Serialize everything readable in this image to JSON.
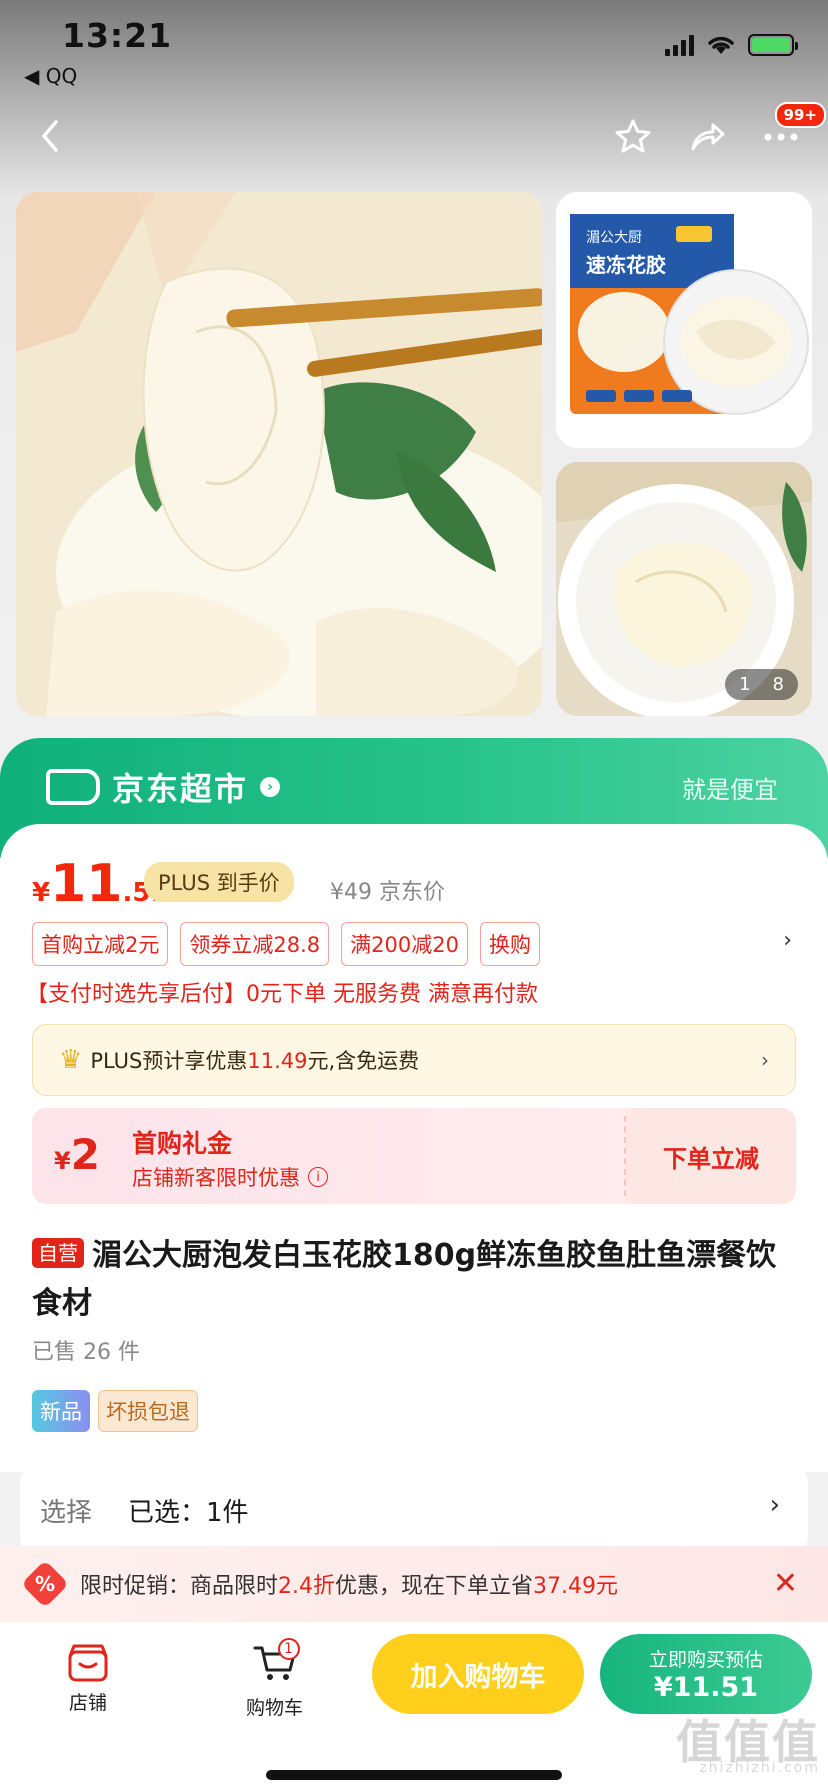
{
  "status_bar": {
    "time": "13:21",
    "back_app": "◀ QQ"
  },
  "nav": {
    "badge": "99+"
  },
  "gallery": {
    "counter_current": "1",
    "counter_total": "8"
  },
  "market": {
    "name": "京东超市",
    "slogan": "就是便宜"
  },
  "price": {
    "symbol": "¥",
    "integer": "11",
    "decimal": ".51",
    "plus_tag": "PLUS 到手价",
    "reference": "¥49 京东价"
  },
  "coupons": [
    "首购立减2元",
    "领券立减28.8",
    "满200减20",
    "换购"
  ],
  "pay_later": "【支付时选先享后付】0元下单 无服务费 满意再付款",
  "plus_bar": {
    "prefix": "PLUS预计享优惠",
    "amount": "11.49",
    "suffix": "元,含免运费"
  },
  "gift": {
    "symbol": "¥",
    "amount": "2",
    "title": "首购礼金",
    "subtitle": "店铺新客限时优惠",
    "info_icon": "i",
    "action": "下单立减"
  },
  "product": {
    "self_tag": "自营",
    "title": "湄公大厨泡发白玉花胶180g鲜冻鱼胶鱼肚鱼漂餐饮食材",
    "sold": "已售 26 件",
    "tags": [
      "新品",
      "坏损包退"
    ]
  },
  "select": {
    "label": "选择",
    "value": "已选：1件"
  },
  "promo": {
    "icon": "%",
    "prefix": "限时促销：商品限时",
    "discount": "2.4折",
    "middle": "优惠，现在下单立省",
    "saving": "37.49元"
  },
  "bottom_bar": {
    "shop_label": "店铺",
    "cart_label": "购物车",
    "cart_count": "1",
    "add_to_cart": "加入购物车",
    "buy_line1": "立即购买预估",
    "buy_line2": "¥11.51"
  },
  "package_text": {
    "brand": "湄公大厨",
    "product": "速冻花胶"
  },
  "watermark": {
    "main": "值值值",
    "sub": "zhizhizhi.com"
  },
  "icons": [
    "back-icon",
    "star-icon",
    "share-icon",
    "more-icon",
    "crown-icon",
    "shop-icon",
    "cart-icon",
    "close-icon"
  ],
  "colors": {
    "jd_red": "#e1251b",
    "market_green": "#19b784",
    "cart_yellow": "#ffcf1b"
  }
}
